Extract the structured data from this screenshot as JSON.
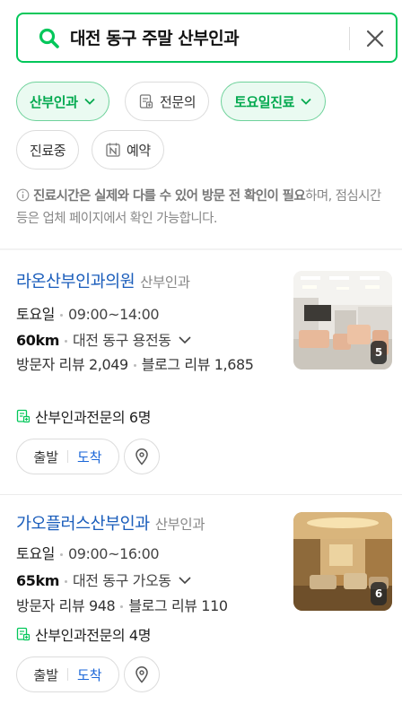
{
  "search": {
    "query": "대전 동구 주말 산부인과",
    "search_icon": "search-icon",
    "clear_icon": "close-icon"
  },
  "filters": [
    {
      "label": "산부인과",
      "active": true,
      "icon": "chevron-down-icon"
    },
    {
      "label": "전문의",
      "active": false,
      "icon": "specialist-icon"
    },
    {
      "label": "토요일진료",
      "active": true,
      "icon": "chevron-down-icon"
    },
    {
      "label": "진료중",
      "active": false
    },
    {
      "label": "예약",
      "active": false,
      "icon": "booking-icon"
    }
  ],
  "notice": {
    "bold": "진료시간은 실제와 다를 수 있어 방문 전 확인이 필요",
    "rest": "하며, 점심시간 등은 업체 페이지에서 확인 가능합니다."
  },
  "results": [
    {
      "name": "라온산부인과의원",
      "category": "산부인과",
      "day": "토요일",
      "hours": "09:00~14:00",
      "distance": "60km",
      "address": "대전 동구 용전동",
      "reviews": "방문자 리뷰 2,049",
      "blog": "블로그 리뷰 1,685",
      "specialists": "산부인과전문의 6명",
      "photo_count": "5",
      "depart_label": "출발",
      "arrive_label": "도착"
    },
    {
      "name": "가오플러스산부인과",
      "category": "산부인과",
      "day": "토요일",
      "hours": "09:00~16:00",
      "distance": "65km",
      "address": "대전 동구 가오동",
      "reviews": "방문자 리뷰 948",
      "blog": "블로그 리뷰 110",
      "specialists": "산부인과전문의 4명",
      "photo_count": "6",
      "depart_label": "출발",
      "arrive_label": "도착"
    }
  ],
  "colors": {
    "accent_green": "#03c75a",
    "link_blue": "#1a5dbb",
    "arrive_blue": "#1a66d8"
  }
}
